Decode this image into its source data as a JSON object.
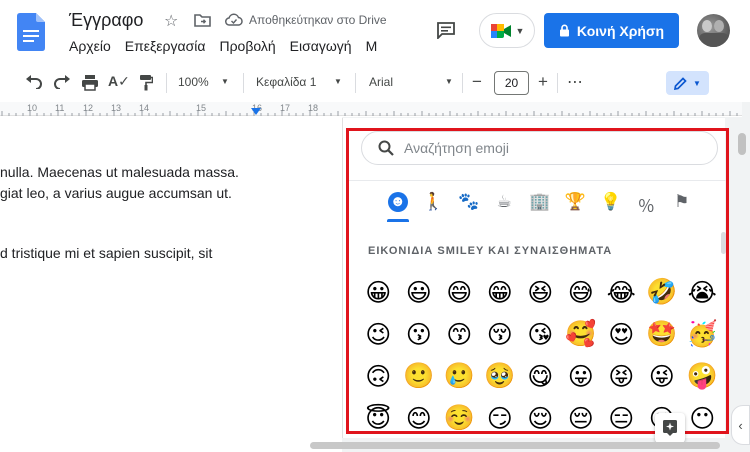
{
  "header": {
    "title": "Έγγραφο",
    "save_status": "Αποθηκεύτηκαν στο Drive",
    "share_label": "Κοινή Χρήση",
    "menu": [
      "Αρχείο",
      "Επεξεργασία",
      "Προβολή",
      "Εισαγωγή",
      "Μ"
    ]
  },
  "toolbar": {
    "zoom": "100%",
    "style": "Κεφαλίδα 1",
    "font": "Arial",
    "font_size": "20",
    "minus": "−",
    "plus": "+",
    "more": "⋯"
  },
  "ruler": {
    "labels": [
      "10",
      "11",
      "12",
      "13",
      "14",
      "15",
      "16",
      "17",
      "18"
    ]
  },
  "document": {
    "lines": [
      "nulla. Maecenas ut malesuada massa.",
      "giat leo, a varius augue accumsan ut.",
      "d tristique mi et sapien suscipit, sit"
    ]
  },
  "emoji_picker": {
    "search_placeholder": "Αναζήτηση emoji",
    "section_title": "ΕΙΚΟΝΙΔΙΑ SMILEY ΚΑΙ ΣΥΝΑΙΣΘΗΜΑΤΑ",
    "categories": [
      {
        "name": "smileys-icon",
        "glyph": "☻",
        "active": true
      },
      {
        "name": "people-icon",
        "glyph": "🚶"
      },
      {
        "name": "animals-icon",
        "glyph": "🐾"
      },
      {
        "name": "food-icon",
        "glyph": "☕"
      },
      {
        "name": "travel-icon",
        "glyph": "🏢"
      },
      {
        "name": "activities-icon",
        "glyph": "🏆"
      },
      {
        "name": "objects-icon",
        "glyph": "💡"
      },
      {
        "name": "symbols-icon",
        "glyph": "％"
      },
      {
        "name": "flags-icon",
        "glyph": "⚑"
      }
    ],
    "emojis": [
      "😀",
      "😃",
      "😄",
      "😁",
      "😆",
      "😅",
      "😂",
      "🤣",
      "😭",
      "😉",
      "😗",
      "😙",
      "😚",
      "😘",
      "🥰",
      "😍",
      "🤩",
      "🥳",
      "🙃",
      "🙂",
      "🥲",
      "🥹",
      "😋",
      "😛",
      "😝",
      "😜",
      "🤪",
      "😇",
      "😊",
      "☺️",
      "😏",
      "😌",
      "😔",
      "😑",
      "😐",
      "😶"
    ]
  },
  "colors": {
    "accent": "#1a73e8",
    "highlight": "#e0141c"
  }
}
